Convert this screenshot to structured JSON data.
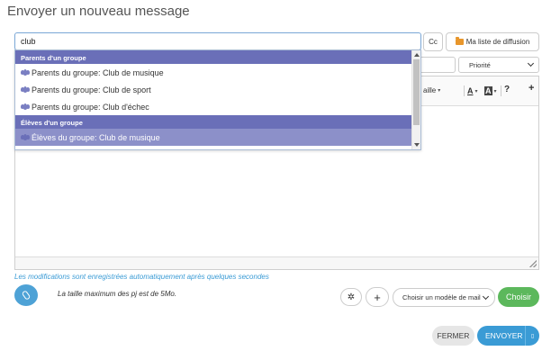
{
  "page": {
    "title": "Envoyer un nouveau message"
  },
  "recipients": {
    "search_value": "club",
    "cc_label": "Cc",
    "distribution_label": "Ma liste de diffusion"
  },
  "priority": {
    "selected": "Priorité"
  },
  "editor": {
    "toolbar_size_label": "aille",
    "help_label": "?",
    "add_label": "+"
  },
  "dropdown": {
    "groups": [
      {
        "header": "Parents d'un groupe",
        "items": [
          "Parents du groupe: Club de musique",
          "Parents du groupe: Club de sport",
          "Parents du groupe: Club d'échec"
        ]
      },
      {
        "header": "Élèves d'un groupe",
        "items": [
          "Élèves du groupe: Club de musique"
        ]
      }
    ],
    "selected_item": "Élèves du groupe: Club de musique"
  },
  "autosave_notice": "Les modifications sont enregistrées automatiquement après quelques secondes",
  "attachments": {
    "size_info": "La taille maximum des pj est de 5Mo."
  },
  "template": {
    "placeholder": "Choisir un modèle de mail",
    "choose_label": "Choisir"
  },
  "footer": {
    "close_label": "FERMER",
    "send_label": "ENVOYER"
  },
  "colors": {
    "group_header": "#6a6fb8",
    "selected_item": "#8c90c9",
    "primary": "#3a9bd5",
    "success": "#5cb85c"
  }
}
